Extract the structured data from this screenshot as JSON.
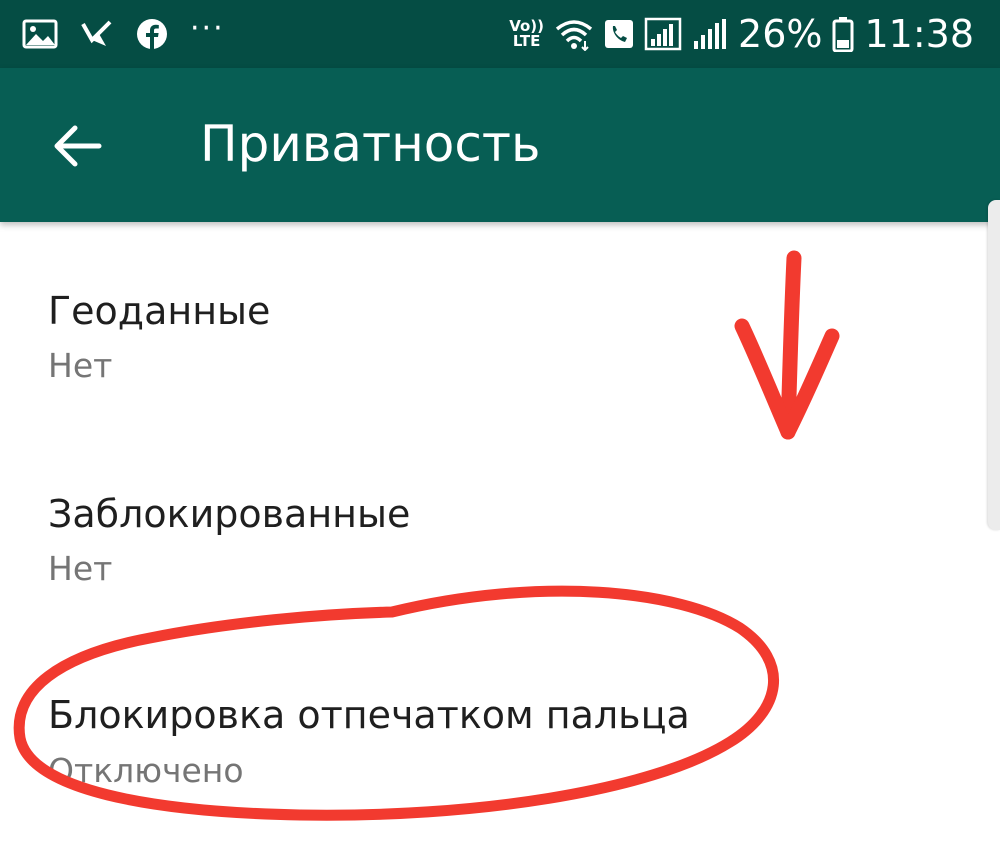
{
  "status_bar": {
    "notification_icons": [
      "gallery-icon",
      "tick-flag-icon",
      "facebook-icon"
    ],
    "more_label": "···",
    "volte_line1": "Vo))",
    "volte_line2": "LTE",
    "status_icons": [
      "wifi-icon",
      "phone-call-icon",
      "signal-icon"
    ],
    "battery_percent": "26%",
    "time": "11:38"
  },
  "toolbar": {
    "back_icon": "arrow-left-icon",
    "title": "Приватность"
  },
  "settings": {
    "items": [
      {
        "title": "Геоданные",
        "value": "Нет"
      },
      {
        "title": "Заблокированные",
        "value": "Нет"
      },
      {
        "title": "Блокировка отпечатком пальца",
        "value": "Отключено"
      }
    ]
  },
  "colors": {
    "status_bar": "#054d44",
    "toolbar": "#075e54",
    "annotation": "#f23a2f",
    "primary_text": "#1f1f1f",
    "secondary_text": "#757575"
  },
  "annotation": {
    "shapes": [
      "down-arrow",
      "ellipse-around-fingerprint-lock"
    ]
  }
}
